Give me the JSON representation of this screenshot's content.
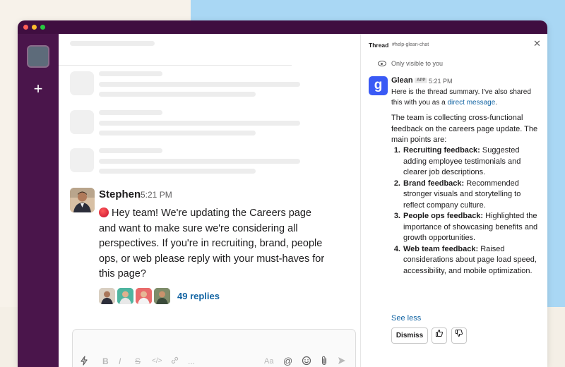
{
  "channel_message": {
    "author": "Stephen",
    "time": "5:21 PM",
    "text": "Hey team! We're updating the Careers page and want to make sure we're considering all perspectives. If you're in recruiting, brand, people ops, or web please reply with your must-haves for this page?",
    "replies_label": "49 replies"
  },
  "composer": {
    "tools": [
      "B",
      "I",
      "S",
      "</>",
      "link",
      "...",
      "Aa",
      "@",
      "emoji",
      "attach",
      "send"
    ]
  },
  "thread": {
    "title": "Thread",
    "channel": "#help-glean-chat",
    "visibility_note": "Only visible to you",
    "bot": {
      "name": "Glean",
      "badge": "APP",
      "time": "5:21 PM",
      "intro_prefix": "Here is the thread summary. I've also shared this with you as a",
      "intro_link": "direct message",
      "intro_suffix": ".",
      "summary": "The team is collecting cross-functional feedback on the careers page update. The main points are:",
      "points": [
        {
          "num": "1.",
          "title": "Recruiting feedback:",
          "text": "Suggested adding employee testimonials and clearer job descriptions."
        },
        {
          "num": "2.",
          "title": "Brand feedback:",
          "text": "Recommended stronger visuals and storytelling to reflect company culture."
        },
        {
          "num": "3.",
          "title": "People ops feedback:",
          "text": "Highlighted the importance of showcasing benefits and growth opportunities."
        },
        {
          "num": "4.",
          "title": "Web team feedback:",
          "text": "Raised considerations about page load speed, accessibility, and mobile optimization."
        }
      ],
      "see_less": "See less",
      "dismiss": "Dismiss"
    }
  },
  "colors": {
    "sidebar": "#4a154b",
    "titlebar": "#3f0e40",
    "link": "#1264a3",
    "glean_brand": "#3a5af5"
  }
}
